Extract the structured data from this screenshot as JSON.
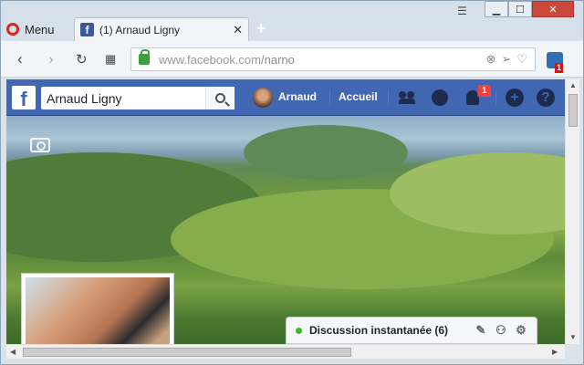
{
  "browser": {
    "menu_label": "Menu",
    "tab_title": "(1) Arnaud Ligny",
    "newtab_label": "+",
    "url_host": "www.facebook.com",
    "url_path": "/narno",
    "extension_badge": "1"
  },
  "facebook": {
    "search_value": "Arnaud Ligny",
    "user_name": "Arnaud",
    "home_label": "Accueil",
    "notification_count": "1"
  },
  "chat": {
    "label": "Discussion instantanée (6)"
  },
  "colors": {
    "fb_blue": "#4267b2",
    "online_green": "#42b72a",
    "badge_red": "#fa3e3e"
  },
  "icons": [
    "opera-icon",
    "facebook-favicon",
    "back-icon",
    "forward-icon",
    "reload-icon",
    "speed-dial-icon",
    "lock-icon",
    "search-icon",
    "friends-icon",
    "messenger-icon",
    "bell-icon",
    "create-icon",
    "help-icon",
    "camera-icon",
    "compose-icon",
    "group-icon",
    "gear-icon"
  ]
}
